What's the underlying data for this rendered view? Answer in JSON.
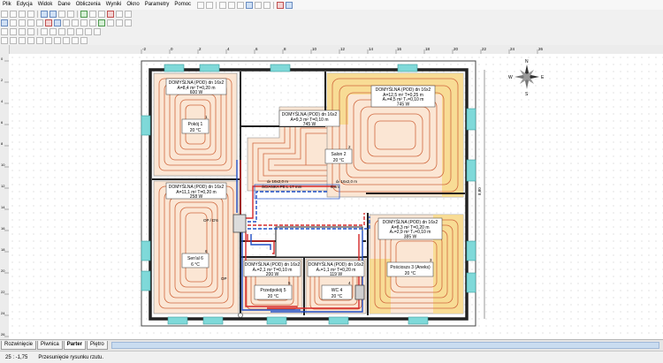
{
  "menu": {
    "items": [
      "Plik",
      "Edycja",
      "Widok",
      "Dane",
      "Obliczenia",
      "Wyniki",
      "Okno",
      "Parametry",
      "Pomoc"
    ]
  },
  "rulers": {
    "top_ticks": [
      "-2",
      "0",
      "2",
      "4",
      "6",
      "8",
      "10",
      "12",
      "14",
      "16",
      "18",
      "20",
      "22",
      "24",
      "26"
    ],
    "left_ticks": [
      "0",
      "2",
      "4",
      "6",
      "8",
      "10",
      "12",
      "14",
      "16",
      "18",
      "20",
      "22",
      "24",
      "26"
    ]
  },
  "compass": {
    "n": "N",
    "s": "S",
    "e": "E",
    "w": "W"
  },
  "rooms": [
    {
      "header": "DOMYŚLNA (POD)  dn 16x2",
      "area": "A=8,4 m² T=0,20 m",
      "power": "600 W",
      "name": "Pokój 1",
      "temp": "20 °C",
      "num": "1"
    },
    {
      "header": "DOMYŚLNA (POD)  dn 16x2",
      "area": "A=9,3 m² T=0,10 m",
      "power": "745 W",
      "name": "Salon 2",
      "temp": "20 °C",
      "num": "2"
    },
    {
      "header": "DOMYŚLNA (POD)  dn 16x2",
      "area": "A=12,5 m² T=0,25 m",
      "area2": "Aₛ=4,5 m² Tₛ=0,10 m",
      "power": "745 W",
      "name": "",
      "temp": "",
      "num": ""
    },
    {
      "header": "DOMYŚLNA (POD)  dn 16x2",
      "area": "A=11,1 m² T=0,20 m",
      "power": "258 W",
      "name": "Sen'al 6",
      "temp": "6 °C",
      "num": "6"
    },
    {
      "header": "DOMYŚLNA (POD)  dn 16x2",
      "area": "A=8,3 m² T=0,20 m",
      "area2": "Aₛ=2,9 m² Tₛ=0,10 m",
      "power": "385 W",
      "name": "Pościoszs 3 (Aneks)",
      "temp": "20 °C",
      "num": "3"
    },
    {
      "header": "DOMYŚLNA (POD)  dn 16x2",
      "area": "Aₛ=2,1 m² T=0,10 m",
      "power": "200 W",
      "name": "Przedpokój 5",
      "temp": "20 °C",
      "num": "5"
    },
    {
      "header": "DOMYŚLNA (POD)  dn 16x2",
      "area": "Aₛ=1,1 m² T=0,20 m",
      "power": "119 W",
      "name": "WC 4",
      "temp": "20 °C",
      "num": "4"
    }
  ],
  "labels": {
    "pipe_a": "dₙ 16x2,0 m",
    "pipe_b": "ŚCIANKA PE L 17 mm",
    "pipe_c": "dₙ 16x2,0 m",
    "pipe_d": "8mm",
    "op1": "OP / D'6",
    "op2": "OP",
    "dim_right": "8,80"
  },
  "tabs": [
    "Rozwinięcie",
    "Piwnica",
    "Parter",
    "Piętro"
  ],
  "status": {
    "coords": "25 : -1,75",
    "message": "Przesunięcie rysunku rzutu."
  }
}
